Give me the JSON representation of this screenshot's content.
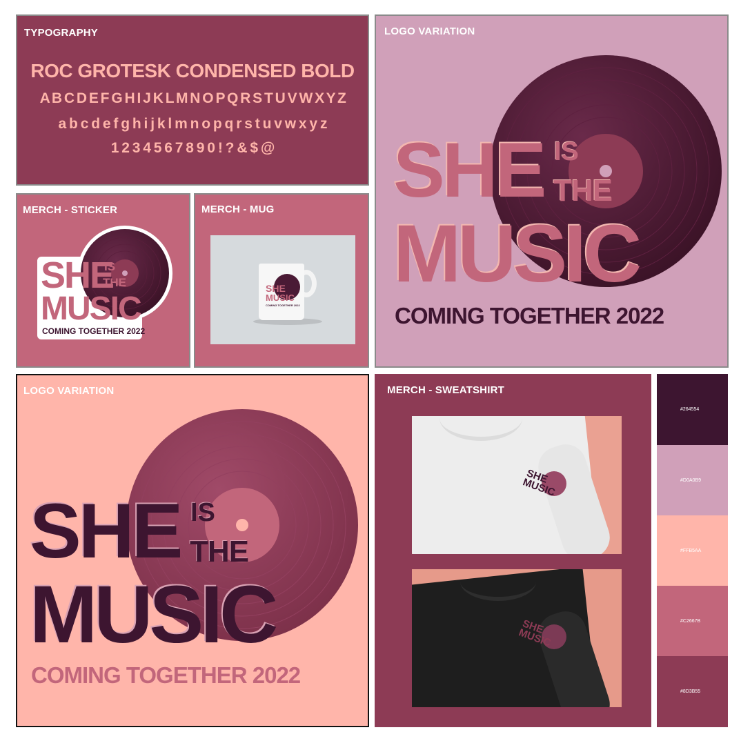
{
  "typography": {
    "label": "TYPOGRAPHY",
    "font_name": "ROC GROTESK CONDENSED BOLD",
    "uppercase": "A B C D E F G H I J K L M N O P Q R S T U V W X Y Z",
    "lowercase": "a b c d e f g h i j k l m n o p q r s t u v w x y z",
    "numerals": "1 2 3 4 5 6 7 8 9 0 ! ? & $ @"
  },
  "merch_sticker": {
    "label": "MERCH - STICKER"
  },
  "merch_mug": {
    "label": "MERCH - MUG",
    "mug_tagline": "COMING TOGETHER 2022"
  },
  "logo_variation_1": {
    "label": "LOGO VARIATION"
  },
  "logo_variation_2": {
    "label": "LOGO VARIATION"
  },
  "merch_sweatshirt": {
    "label": "MERCH - SWEATSHIRT"
  },
  "logo": {
    "word_she": "SHE",
    "word_is": "IS",
    "word_the": "THE",
    "word_music": "MUSIC",
    "tagline": "COMING TOGETHER 2022"
  },
  "palette": [
    {
      "hex": "#264554",
      "color": "#3D1530"
    },
    {
      "hex": "#D0A0B9",
      "color": "#D0A0B9"
    },
    {
      "hex": "#FFB5AA",
      "color": "#FFB5AA"
    },
    {
      "hex": "#C2667B",
      "color": "#C2667B"
    },
    {
      "hex": "#8D3B55",
      "color": "#8D3B55"
    }
  ],
  "colors": {
    "dark_plum": "#3D1530",
    "mauve": "#D0A0B9",
    "peach": "#FFB5AA",
    "rose": "#C2667B",
    "berry": "#8D3B55"
  }
}
